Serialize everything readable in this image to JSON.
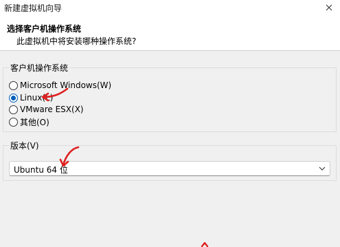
{
  "window": {
    "title": "新建虚拟机向导",
    "close_icon": "close-icon"
  },
  "header": {
    "title": "选择客户机操作系统",
    "subtitle": "此虚拟机中将安装哪种操作系统?"
  },
  "os_group": {
    "legend": "客户机操作系统",
    "options": [
      {
        "label": "Microsoft Windows(W)",
        "checked": false
      },
      {
        "label": "Linux(L)",
        "checked": true
      },
      {
        "label": "VMware ESX(X)",
        "checked": false
      },
      {
        "label": "其他(O)",
        "checked": false
      }
    ]
  },
  "version_group": {
    "legend": "版本(V)",
    "selected": "Ubuntu 64 位",
    "chevron_icon": "chevron-down-icon"
  },
  "annotations": {
    "color": "#e02020",
    "icon": "red-arrow"
  }
}
